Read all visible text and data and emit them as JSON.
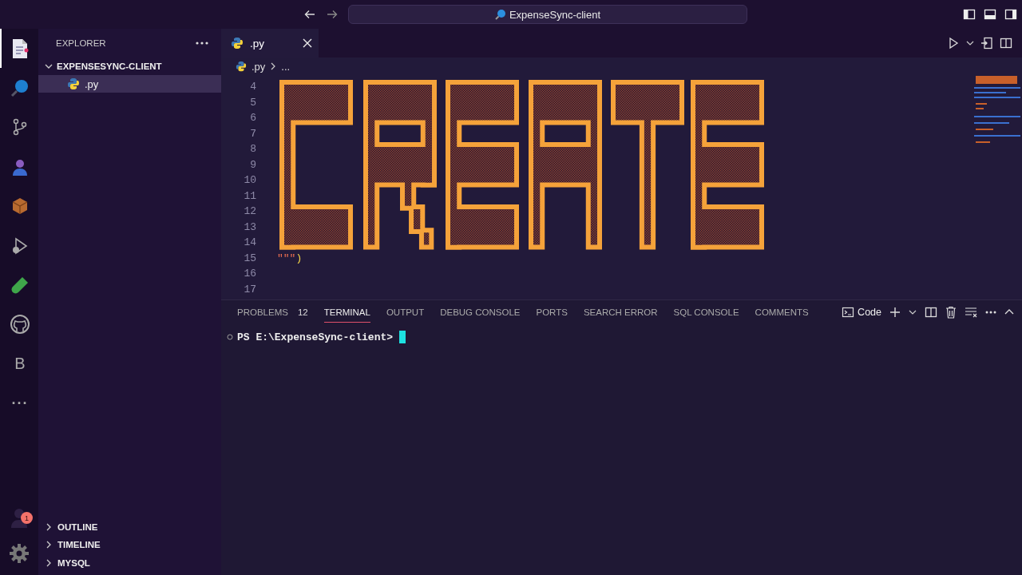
{
  "title_bar": {
    "search": "ExpenseSync-client"
  },
  "activity_bar": {
    "items": [
      {
        "kind": "explorer",
        "selected": true
      },
      {
        "kind": "search",
        "selected": false
      },
      {
        "kind": "source-control",
        "selected": false
      },
      {
        "kind": "person",
        "selected": false
      },
      {
        "kind": "package",
        "selected": false
      },
      {
        "kind": "run",
        "selected": false
      },
      {
        "kind": "flask",
        "selected": false
      },
      {
        "kind": "github",
        "selected": false
      },
      {
        "kind": "letter",
        "text": "B",
        "selected": false
      },
      {
        "kind": "more",
        "text": "···",
        "selected": false
      }
    ],
    "account_badge": "1"
  },
  "sidebar": {
    "title": "EXPLORER",
    "root": {
      "label": "EXPENSESYNC-CLIENT",
      "expanded": true,
      "children": [
        {
          "label": ".py",
          "selected": true
        }
      ]
    },
    "sections": [
      {
        "label": "OUTLINE",
        "expanded": false
      },
      {
        "label": "TIMELINE",
        "expanded": false
      },
      {
        "label": "MYSQL",
        "expanded": false
      }
    ]
  },
  "editor": {
    "tabs": [
      {
        "label": ".py",
        "selected": true
      }
    ],
    "breadcrumb": [
      ".py",
      "..."
    ],
    "lines": [
      {
        "number": "4"
      },
      {
        "number": "5"
      },
      {
        "number": "6"
      },
      {
        "number": "7"
      },
      {
        "number": "8"
      },
      {
        "number": "9"
      },
      {
        "number": "10"
      },
      {
        "number": "11"
      },
      {
        "number": "12"
      },
      {
        "number": "13"
      },
      {
        "number": "14"
      },
      {
        "number": "15",
        "parts": [
          {
            "text": "\"\"\"",
            "kind": "string"
          },
          {
            "text": ")",
            "kind": "bracket"
          }
        ]
      },
      {
        "number": "16"
      },
      {
        "number": "17"
      }
    ]
  },
  "panel": {
    "tabs": [
      {
        "label": "PROBLEMS",
        "badge": "12",
        "selected": false
      },
      {
        "label": "TERMINAL",
        "selected": true
      },
      {
        "label": "OUTPUT",
        "selected": false
      },
      {
        "label": "DEBUG CONSOLE",
        "selected": false
      },
      {
        "label": "PORTS",
        "selected": false
      },
      {
        "label": "SEARCH ERROR",
        "selected": false
      },
      {
        "label": "SQL CONSOLE",
        "selected": false
      },
      {
        "label": "COMMENTS",
        "selected": false
      }
    ],
    "terminal_profile": "Code",
    "prompt": "PS E:\\ExpenseSync-client>"
  }
}
